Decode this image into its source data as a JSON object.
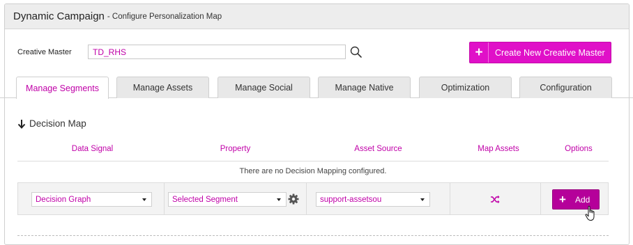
{
  "header": {
    "title": "Dynamic Campaign",
    "subtitle": "- Configure Personalization Map"
  },
  "creative_master": {
    "label": "Creative Master",
    "value": "TD_RHS",
    "create_button_label": "Create New Creative Master"
  },
  "tabs": [
    {
      "label": "Manage Segments",
      "active": true
    },
    {
      "label": "Manage Assets",
      "active": false
    },
    {
      "label": "Manage Social",
      "active": false
    },
    {
      "label": "Manage Native",
      "active": false
    },
    {
      "label": "Optimization",
      "active": false
    },
    {
      "label": "Configuration",
      "active": false
    }
  ],
  "decision_map": {
    "title": "Decision Map",
    "columns": [
      "Data Signal",
      "Property",
      "Asset Source",
      "Map Assets",
      "Options"
    ],
    "empty_message": "There are no Decision Mapping configured.",
    "row": {
      "data_signal": "Decision Graph",
      "property": "Selected Segment",
      "asset_source": "support-assetsou",
      "add_label": "Add"
    }
  },
  "colors": {
    "accent": "#e010c8",
    "accent_dark": "#b5009a",
    "link_text": "#c000a8"
  },
  "icons": [
    "search-icon",
    "arrow-down-icon",
    "gear-icon",
    "shuffle-icon",
    "plus-icon",
    "hand-cursor-icon"
  ]
}
